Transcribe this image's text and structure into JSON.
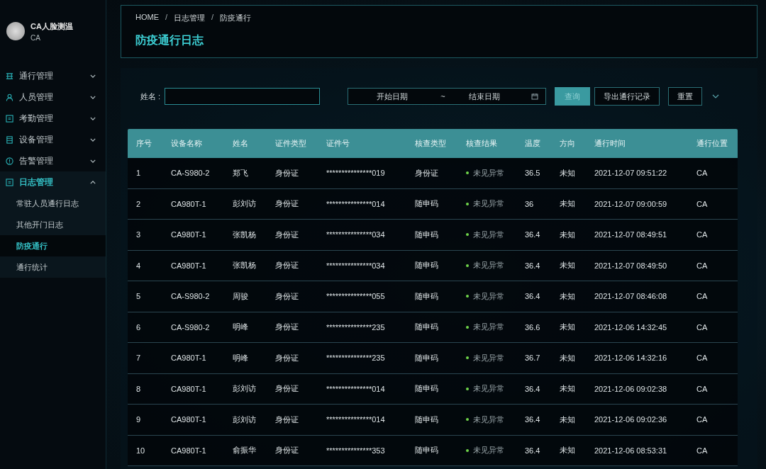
{
  "sidebar": {
    "app_name": "CA人脸测温",
    "app_sub": "CA",
    "menu": [
      {
        "kind": "grid",
        "label": "通行管理",
        "expanded": false
      },
      {
        "kind": "person",
        "label": "人员管理",
        "expanded": false
      },
      {
        "kind": "card",
        "label": "考勤管理",
        "expanded": false
      },
      {
        "kind": "list",
        "label": "设备管理",
        "expanded": false
      },
      {
        "kind": "alert",
        "label": "告警管理",
        "expanded": false
      },
      {
        "kind": "card",
        "label": "日志管理",
        "expanded": true,
        "children": [
          {
            "label": "常驻人员通行日志",
            "selected": false
          },
          {
            "label": "其他开门日志",
            "selected": false
          },
          {
            "label": "防疫通行",
            "selected": true
          },
          {
            "label": "通行统计",
            "selected": false
          }
        ]
      }
    ]
  },
  "breadcrumb": [
    "HOME",
    "日志管理",
    "防疫通行"
  ],
  "breadcrumb_separator": "/",
  "page_title": "防疫通行日志",
  "filters": {
    "name_label": "姓名 :",
    "start_placeholder": "开始日期",
    "range_separator": "~",
    "end_placeholder": "结束日期",
    "buttons": [
      {
        "kind": "primary",
        "label": "查询"
      },
      {
        "kind": "outline",
        "label": "导出通行记录"
      },
      {
        "kind": "outline",
        "label": "重置"
      }
    ]
  },
  "table": {
    "columns": [
      "序号",
      "设备名称",
      "姓名",
      "证件类型",
      "证件号",
      "核查类型",
      "核查结果",
      "温度",
      "方向",
      "通行时间",
      "通行位置"
    ],
    "rows": [
      [
        "1",
        "CA-S980-2",
        "郑飞",
        "身份证",
        "***************019",
        "身份证",
        "未见异常",
        "36.5",
        "未知",
        "2021-12-07 09:51:22",
        "CA"
      ],
      [
        "2",
        "CA980T-1",
        "彭刘访",
        "身份证",
        "***************014",
        "随申码",
        "未见异常",
        "36",
        "未知",
        "2021-12-07 09:00:59",
        "CA"
      ],
      [
        "3",
        "CA980T-1",
        "张凯杨",
        "身份证",
        "***************034",
        "随申码",
        "未见异常",
        "36.4",
        "未知",
        "2021-12-07 08:49:51",
        "CA"
      ],
      [
        "4",
        "CA980T-1",
        "张凯杨",
        "身份证",
        "***************034",
        "随申码",
        "未见异常",
        "36.4",
        "未知",
        "2021-12-07 08:49:50",
        "CA"
      ],
      [
        "5",
        "CA-S980-2",
        "周骏",
        "身份证",
        "***************055",
        "随申码",
        "未见异常",
        "36.4",
        "未知",
        "2021-12-07 08:46:08",
        "CA"
      ],
      [
        "6",
        "CA-S980-2",
        "明峰",
        "身份证",
        "***************235",
        "随申码",
        "未见异常",
        "36.6",
        "未知",
        "2021-12-06 14:32:45",
        "CA"
      ],
      [
        "7",
        "CA980T-1",
        "明峰",
        "身份证",
        "***************235",
        "随申码",
        "未见异常",
        "36.7",
        "未知",
        "2021-12-06 14:32:16",
        "CA"
      ],
      [
        "8",
        "CA980T-1",
        "彭刘访",
        "身份证",
        "***************014",
        "随申码",
        "未见异常",
        "36.4",
        "未知",
        "2021-12-06 09:02:38",
        "CA"
      ],
      [
        "9",
        "CA980T-1",
        "彭刘访",
        "身份证",
        "***************014",
        "随申码",
        "未见异常",
        "36.4",
        "未知",
        "2021-12-06 09:02:36",
        "CA"
      ],
      [
        "10",
        "CA980T-1",
        "俞振华",
        "身份证",
        "***************353",
        "随申码",
        "未见异常",
        "36.4",
        "未知",
        "2021-12-06 08:53:31",
        "CA"
      ]
    ]
  }
}
